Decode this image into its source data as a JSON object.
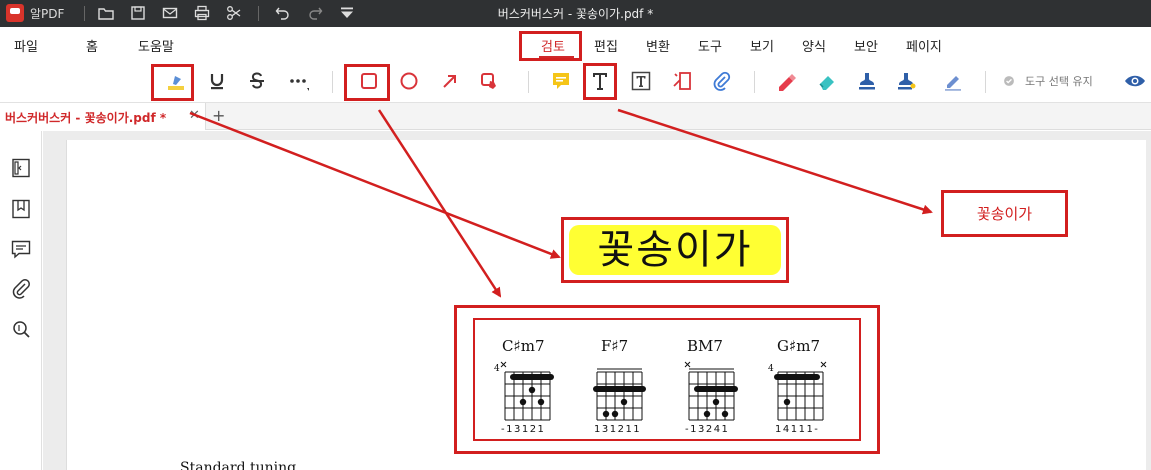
{
  "titlebar": {
    "app_name": "알PDF",
    "title": "버스커버스커 - 꽃송이가.pdf *"
  },
  "menu": {
    "items": [
      {
        "label": "파일"
      },
      {
        "label": "홈"
      },
      {
        "label": "도움말"
      },
      {
        "label": "검토",
        "active": true
      },
      {
        "label": "편집"
      },
      {
        "label": "변환"
      },
      {
        "label": "도구"
      },
      {
        "label": "보기"
      },
      {
        "label": "양식"
      },
      {
        "label": "보안"
      },
      {
        "label": "페이지"
      }
    ]
  },
  "toolbar": {
    "keep_tool_label": "도구 선택 유지"
  },
  "tabs": {
    "doc_tab_label": "버스커버스커 - 꽃송이가.pdf *",
    "close_glyph": "✕",
    "add_glyph": "+"
  },
  "document": {
    "text_annotation": "꽃송이가",
    "big_text": "꽃송이가",
    "chords": [
      {
        "name": "C♯m7",
        "fret": "4",
        "fingers": "-13121"
      },
      {
        "name": "F♯7",
        "fret": "",
        "fingers": "131211"
      },
      {
        "name": "BM7",
        "fret": "",
        "fingers": "-13241"
      },
      {
        "name": "G♯m7",
        "fret": "4",
        "fingers": "14111-"
      }
    ],
    "footer_text": "Standard tuning"
  },
  "colors": {
    "accent_red": "#d0282a",
    "annotation_red": "#d21f1f",
    "highlight_yellow": "#ffff33",
    "titlebar_bg": "#2f3133"
  }
}
